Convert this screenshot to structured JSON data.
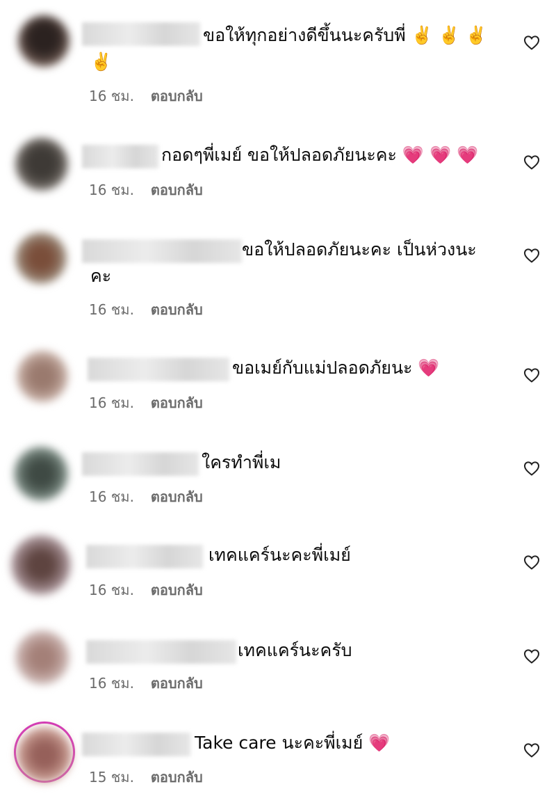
{
  "comments": [
    {
      "text": "ขอให้ทุกอย่างดีขึ้นนะครับพี่ ✌️ ✌️ ✌️ ✌️",
      "time": "16 ชม.",
      "reply": "ตอบกลับ",
      "avatar_color": "#3a2f2c"
    },
    {
      "text": "กอดๆพี่เมย์ ขอให้ปลอดภัยนะคะ 💗 💗 💗",
      "time": "16 ชม.",
      "reply": "ตอบกลับ",
      "avatar_color": "#4e4a46"
    },
    {
      "text": "ขอให้ปลอดภัยนะคะ เป็นห่วงนะคะ",
      "time": "16 ชม.",
      "reply": "ตอบกลับ",
      "avatar_color": "#8a6a55"
    },
    {
      "text": "ขอเมย์กับแม่ปลอดภัยนะ 💗",
      "time": "16 ชม.",
      "reply": "ตอบกลับ",
      "avatar_color": "#a88b80"
    },
    {
      "text": "ใครทำพี่เม",
      "time": "16 ชม.",
      "reply": "ตอบกลับ",
      "avatar_color": "#5a655f"
    },
    {
      "text": "เทคแคร์นะคะพี่เมย์",
      "time": "16 ชม.",
      "reply": "ตอบกลับ",
      "avatar_color": "#8b6e6c"
    },
    {
      "text": "เทคแคร์นะครับ",
      "time": "16 ชม.",
      "reply": "ตอบกลับ",
      "avatar_color": "#b79a95"
    },
    {
      "text": "Take care นะคะพี่เมย์ 💗",
      "time": "15 ชม.",
      "reply": "ตอบกลับ",
      "avatar_color": "#b7857a"
    }
  ],
  "icons": {
    "like": "heart-outline-icon"
  },
  "colors": {
    "text": "#0b0b0b",
    "meta": "#6b6b6b",
    "story_ring": "#d42fb8"
  }
}
